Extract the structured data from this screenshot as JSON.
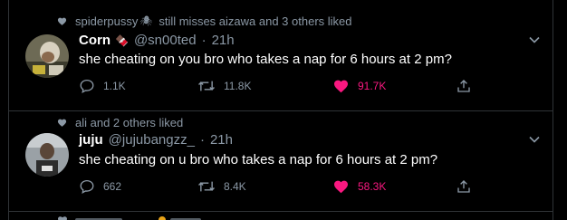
{
  "tweets": [
    {
      "social": {
        "user": "spiderpussy",
        "icon": "spider-icon",
        "text": "still misses aizawa and 3 others liked"
      },
      "name": "Corn",
      "name_emoji": "🍫",
      "handle": "@sn00ted",
      "time": "21h",
      "text": "she cheating on you bro who takes a nap for 6 hours at 2 pm?",
      "replies": "1.1K",
      "retweets": "11.8K",
      "likes": "91.7K"
    },
    {
      "social": {
        "text": "ali and 2 others liked"
      },
      "name": "juju",
      "handle": "@jujubangzz_",
      "time": "21h",
      "text": "she cheating on u bro who takes a nap for 6 hours at 2 pm?",
      "replies": "662",
      "retweets": "8.4K",
      "likes": "58.3K"
    }
  ],
  "colors": {
    "background": "#000000",
    "secondary_text": "#8b98a5",
    "like": "#f91880",
    "divider": "#2f3336"
  }
}
